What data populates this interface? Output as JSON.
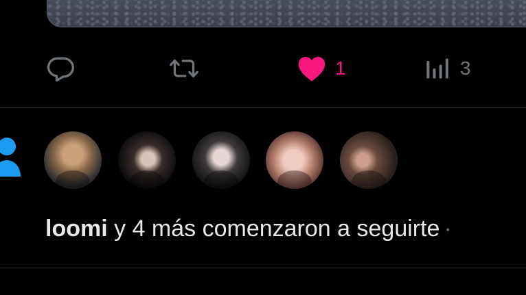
{
  "post": {
    "actions": {
      "reply": {
        "icon": "reply-icon"
      },
      "retweet": {
        "icon": "retweet-icon"
      },
      "like": {
        "icon": "heart-icon",
        "count": "1",
        "active": true
      },
      "views": {
        "icon": "views-icon",
        "count": "3"
      }
    }
  },
  "notification": {
    "icon": "person-icon",
    "username": "loomi",
    "message": " y 4 más comenzaron a seguirte",
    "separator": "·",
    "avatars": [
      {
        "name": "avatar-loomi"
      },
      {
        "name": "avatar-2"
      },
      {
        "name": "avatar-3"
      },
      {
        "name": "avatar-4"
      },
      {
        "name": "avatar-5"
      }
    ]
  },
  "colors": {
    "background": "#000000",
    "text": "#e7e9ea",
    "muted": "#71767b",
    "like": "#f91880",
    "accent": "#1d9bf0",
    "divider": "#2f3336"
  }
}
